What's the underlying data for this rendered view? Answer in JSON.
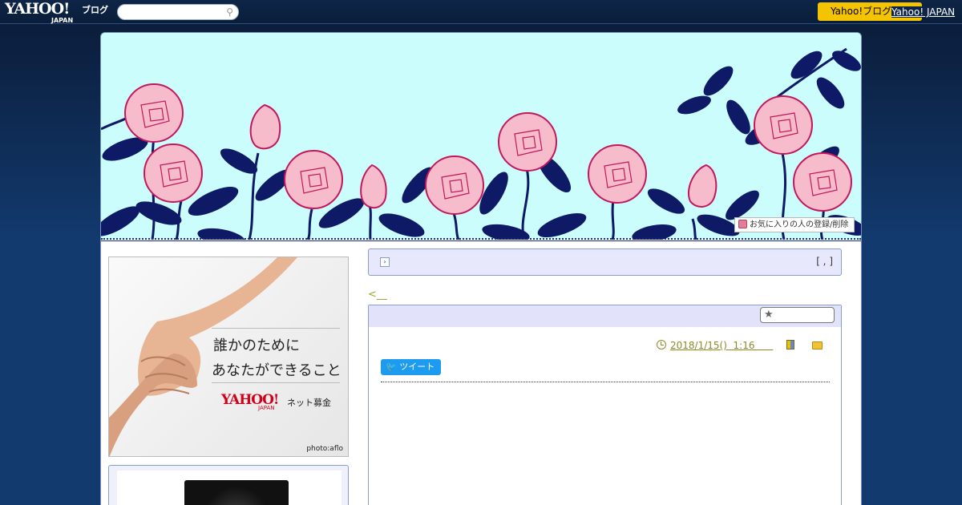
{
  "topbar": {
    "logo": "YAHOO!",
    "logo_sub": "JAPAN",
    "service": "ブログ",
    "search_placeholder": "",
    "search_icon": "search-icon",
    "signup_button": "Yahoo!ブログ",
    "yahoo_link": "Yahoo! JAPAN"
  },
  "header": {
    "favorite_button": "お気に入りの人の登録/削除",
    "colors": {
      "background": "#ccfdfd",
      "leaves": "#0f1a66",
      "rose": "#f6bccb",
      "rose_outline": "#c2185b"
    }
  },
  "ad": {
    "line1": "誰かのために",
    "line2": "あなたができること",
    "brand": "YAHOO!",
    "brand_sub": "JAPAN",
    "service": "ネット募金",
    "credit": "photo:aflo"
  },
  "title_bar": {
    "icon": "arrow-icon",
    "meta": "[ , ]"
  },
  "nav": {
    "prev_link": "<__"
  },
  "entry": {
    "star_icon": "★",
    "date": "2018/1/15()  1:16      ",
    "tweet_button": "ツイート",
    "tweet_icon": "twitter-bird-icon"
  }
}
